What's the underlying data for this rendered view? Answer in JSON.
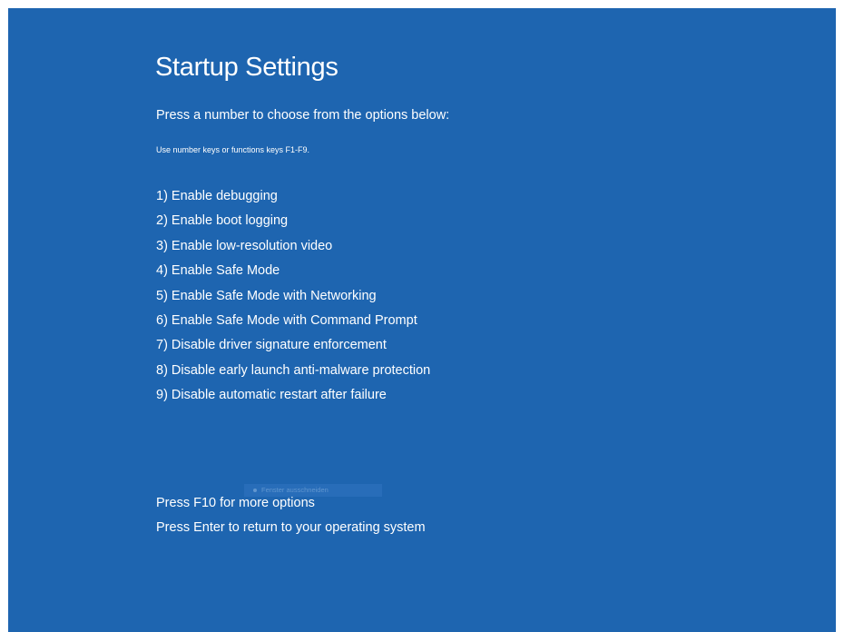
{
  "screen": {
    "title": "Startup Settings",
    "subtitle": "Press a number to choose from the options below:",
    "hint": "Use number keys or functions keys F1-F9.",
    "options": [
      "1) Enable debugging",
      "2) Enable boot logging",
      "3) Enable low-resolution video",
      "4) Enable Safe Mode",
      "5) Enable Safe Mode with Networking",
      "6) Enable Safe Mode with Command Prompt",
      "7) Disable driver signature enforcement",
      "8) Disable early launch anti-malware protection",
      "9) Disable automatic restart after failure"
    ],
    "more_options": "Press F10 for more options",
    "return_text": "Press Enter to return to your operating system"
  },
  "overlay": {
    "label": "Fenster ausschneiden"
  },
  "colors": {
    "background": "#1e65b0",
    "text": "#ffffff"
  }
}
